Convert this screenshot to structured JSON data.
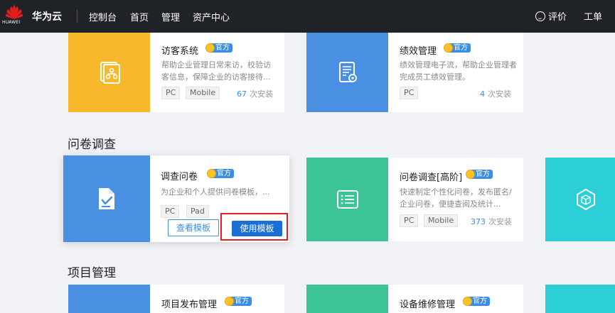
{
  "header": {
    "logo_text": "HUAWEI",
    "brand": "华为云",
    "nav": [
      "控制台",
      "首页",
      "管理",
      "资产中心"
    ],
    "evaluate": "评价",
    "ticket": "工单"
  },
  "official_badge": "官方",
  "install_suffix": "次安装",
  "sections": [
    {
      "cards": [
        {
          "name": "访客系统",
          "desc": "帮助企业管理日常来访，校验访客信息，保障企业的访客接待...",
          "tags": [
            "PC",
            "Mobile"
          ],
          "installs": "67",
          "icon": "org-chart-icon",
          "color": "#f8b82b"
        },
        {
          "name": "绩效管理",
          "desc": "绩效管理电子流，帮助企业管理者完成员工绩效管理。",
          "tags": [
            "PC"
          ],
          "installs": "4",
          "icon": "document-gear-icon",
          "color": "#4a90e2"
        }
      ]
    },
    {
      "title": "问卷调查",
      "cards": [
        {
          "name": "调查问卷",
          "desc": "为企业和个人提供问卷模板，...",
          "tags": [
            "PC",
            "Pad"
          ],
          "icon": "survey-check-icon",
          "color": "#4a90e2",
          "view_button": "查看模板",
          "use_button": "使用模板"
        },
        {
          "name": "问卷调查[高阶]",
          "desc": "快速制定个性化问卷，发布匿名/企业问卷，便捷查阅及统计...",
          "tags": [
            "PC",
            "Mobile"
          ],
          "installs": "373",
          "icon": "list-icon",
          "color": "#3cc496"
        },
        {
          "icon": "cube-network-icon",
          "color": "#2ccfd6"
        }
      ]
    },
    {
      "title": "项目管理",
      "cards": [
        {
          "name": "项目发布管理",
          "icon": "project-icon",
          "color": "#4a90e2"
        },
        {
          "name": "设备维修管理",
          "icon": "repair-icon",
          "color": "#3cc496"
        },
        {
          "icon": "app-icon",
          "color": "#2ccfd6"
        }
      ]
    }
  ]
}
